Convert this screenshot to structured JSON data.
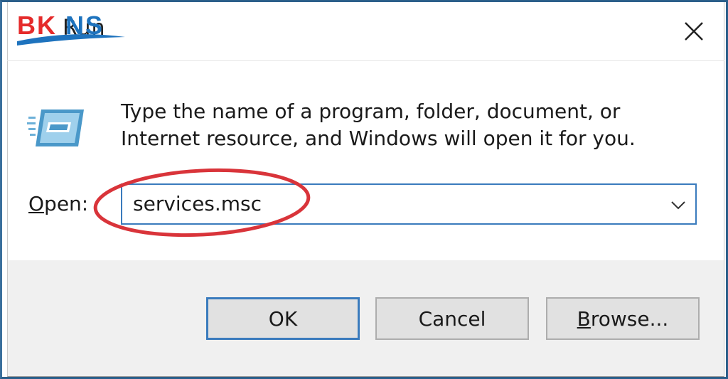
{
  "window": {
    "title": "Run",
    "watermark_text": "BKNS",
    "close_icon": "close-icon"
  },
  "content": {
    "icon": "run-program-icon",
    "description": "Type the name of a program, folder, document, or Internet resource, and Windows will open it for you."
  },
  "open_field": {
    "label_underlined": "O",
    "label_rest": "pen:",
    "value": "services.msc",
    "dropdown_icon": "chevron-down-icon",
    "annotation_color": "#d9343a"
  },
  "buttons": {
    "ok": "OK",
    "cancel": "Cancel",
    "browse_underlined": "B",
    "browse_rest": "rowse..."
  },
  "colors": {
    "accent": "#3a7bbd",
    "logo_red": "#e52b2b",
    "logo_blue": "#1e73be"
  }
}
